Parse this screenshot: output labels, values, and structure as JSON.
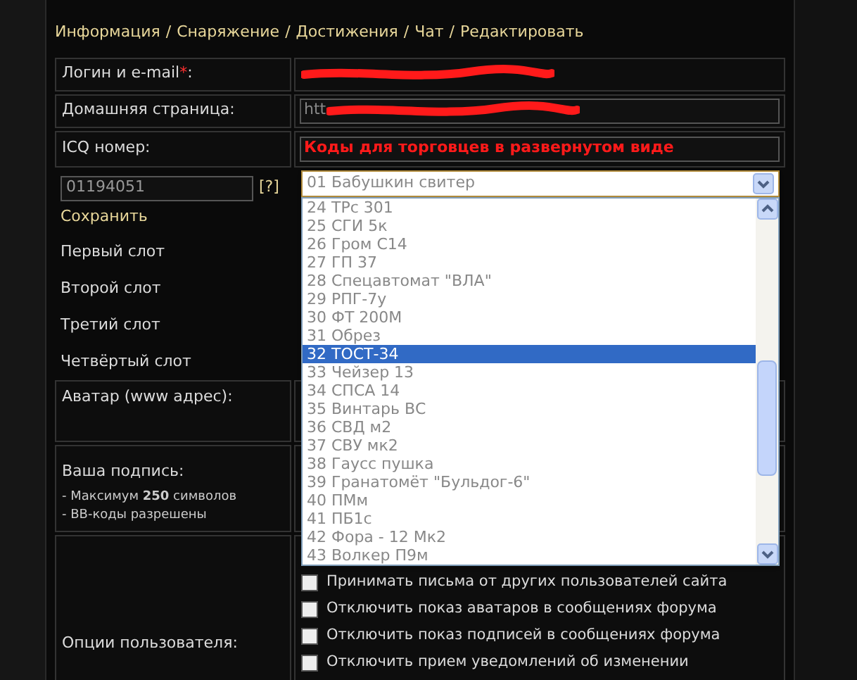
{
  "nav": [
    "Информация",
    "Снаряжение",
    "Достижения",
    "Чат",
    "Редактировать"
  ],
  "nav_separator": "/",
  "login": {
    "label": "Логин и e-mail",
    "required_mark": "*",
    "label_end": ":",
    "redacted": true
  },
  "homepage": {
    "label": "Домашняя страница:",
    "value": "htt",
    "redacted": true
  },
  "icq": {
    "label": "ICQ номер:",
    "annotation": "Коды для торговцев в развернутом виде"
  },
  "icq_number": {
    "value": "01194051",
    "help": "[?]",
    "save": "Сохранить"
  },
  "item_select": {
    "value": "01 Бабушкин свитер",
    "options": [
      {
        "label": "24 TPc 301",
        "selected": false
      },
      {
        "label": "25 СГИ 5к",
        "selected": false
      },
      {
        "label": "26 Гром С14",
        "selected": false
      },
      {
        "label": "27 ГП 37",
        "selected": false
      },
      {
        "label": "28 Спецавтомат \"ВЛА\"",
        "selected": false
      },
      {
        "label": "29 РПГ-7у",
        "selected": false
      },
      {
        "label": "30 ФТ 200М",
        "selected": false
      },
      {
        "label": "31 Обрез",
        "selected": false
      },
      {
        "label": "32 ТОСТ-34",
        "selected": true
      },
      {
        "label": "33 Чейзер 13",
        "selected": false
      },
      {
        "label": "34 СПСА 14",
        "selected": false
      },
      {
        "label": "35 Винтарь ВС",
        "selected": false
      },
      {
        "label": "36 СВД м2",
        "selected": false
      },
      {
        "label": "37 СВУ мк2",
        "selected": false
      },
      {
        "label": "38 Гаусс пушка",
        "selected": false
      },
      {
        "label": "39 Гранатомёт \"Бульдог-6\"",
        "selected": false
      },
      {
        "label": "40 ПМм",
        "selected": false
      },
      {
        "label": "41 ПБ1с",
        "selected": false
      },
      {
        "label": "42 Фора - 12 Мк2",
        "selected": false
      },
      {
        "label": "43 Волкер П9м",
        "selected": false
      }
    ]
  },
  "slots": [
    "Первый слот",
    "Второй слот",
    "Третий слот",
    "Четвёртый слот"
  ],
  "avatar": {
    "label": "Аватар (www адрес):"
  },
  "signature": {
    "label": "Ваша подпись:",
    "notes": [
      "- Максимум **250** символов",
      "- BB-коды разрешены"
    ]
  },
  "options": {
    "label": "Опции пользователя:",
    "checkboxes": [
      {
        "label": "Принимать письма от других пользователей сайта",
        "checked": false
      },
      {
        "label": "Отключить показ аватаров в сообщениях форума",
        "checked": false
      },
      {
        "label": "Отключить показ подписей в сообщениях форума",
        "checked": false
      },
      {
        "label": "Отключить прием уведомлений об изменении",
        "checked": false
      }
    ]
  }
}
